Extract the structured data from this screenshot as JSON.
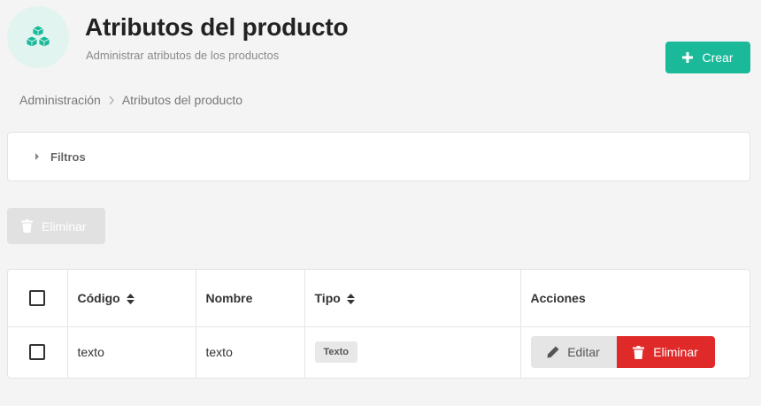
{
  "header": {
    "icon": "cubes-icon",
    "title": "Atributos del producto",
    "subtitle": "Administrar atributos de los productos",
    "create_label": "Crear"
  },
  "breadcrumb": [
    "Administración",
    "Atributos del producto"
  ],
  "filters": {
    "label": "Filtros"
  },
  "bulk_delete_label": "Eliminar",
  "table": {
    "columns": [
      "Código",
      "Nombre",
      "Tipo",
      "Acciones"
    ],
    "rows": [
      {
        "code": "texto",
        "name": "texto",
        "type": "Texto",
        "edit_label": "Editar",
        "delete_label": "Eliminar"
      }
    ]
  },
  "colors": {
    "accent": "#1ab99a",
    "danger": "#e02a2a",
    "icon_bg": "#e2f4ef"
  }
}
